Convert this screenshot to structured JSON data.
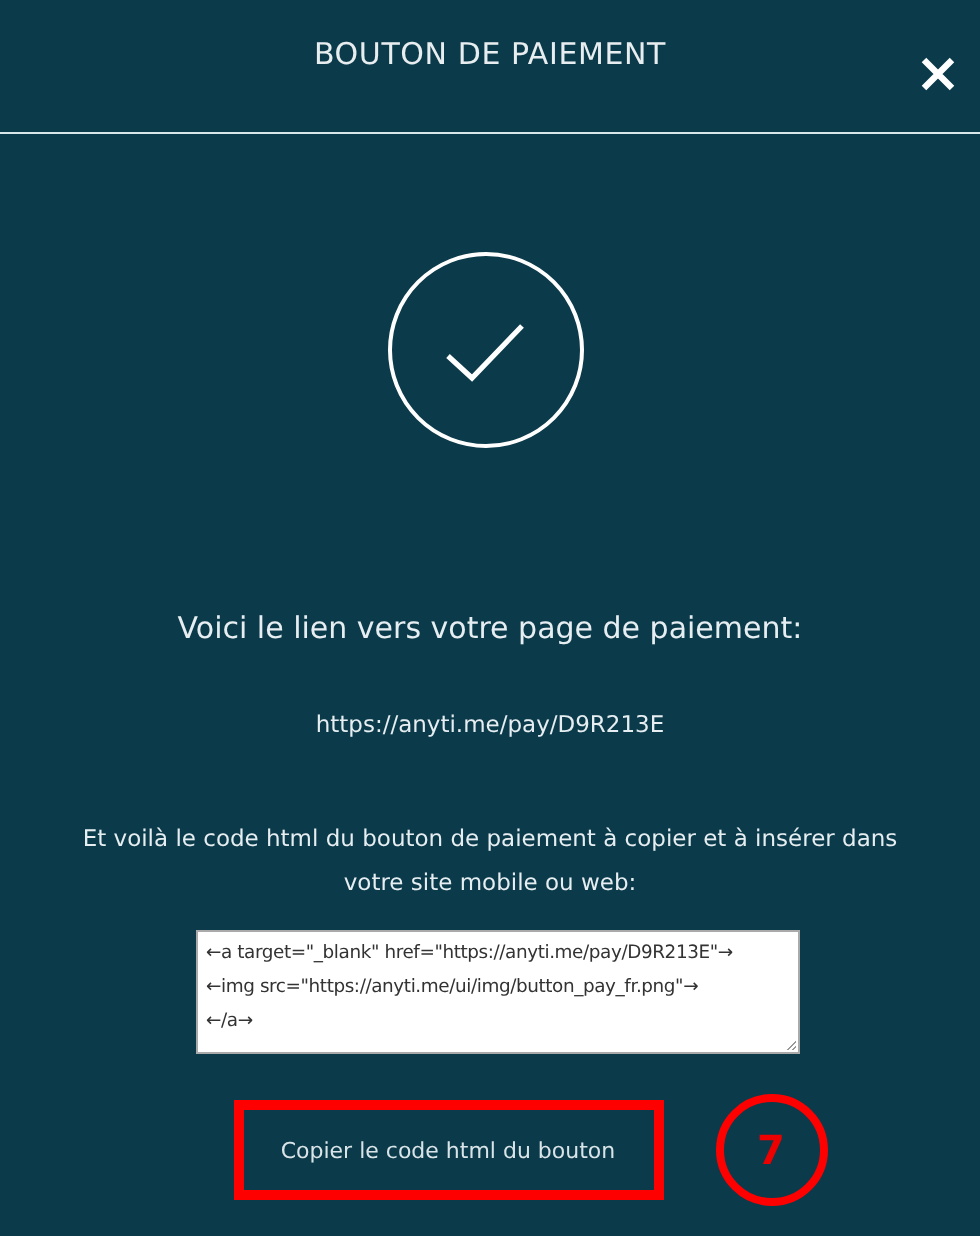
{
  "dialog": {
    "title": "BOUTON DE PAIEMENT"
  },
  "heading": "Voici le lien vers votre page de paiement:",
  "payment_link": "https://anyti.me/pay/D9R213E",
  "instructions": "Et voilà le code html du bouton de paiement à copier et à insérer dans votre site mobile ou web:",
  "code_lines": [
    "←a target=\"_blank\" href=\"https://anyti.me/pay/D9R213E\"→",
    "←img src=\"https://anyti.me/ui/img/button_pay_fr.png\"→",
    "←/a→"
  ],
  "copy_button": {
    "label": "Copier le code html du bouton"
  },
  "annotation": {
    "number": "7"
  }
}
